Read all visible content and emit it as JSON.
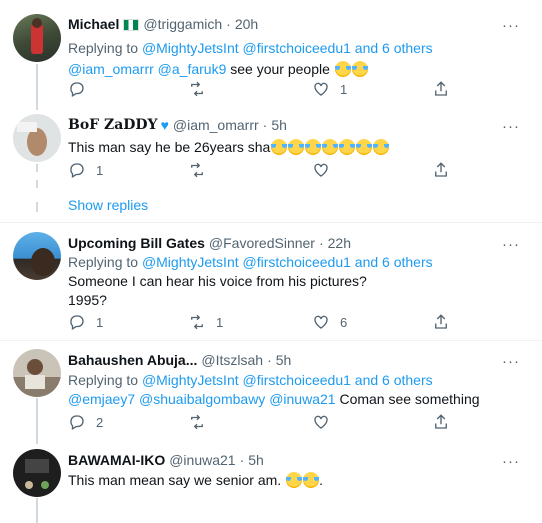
{
  "colors": {
    "accent": "#1d9bf0",
    "muted": "#536471",
    "text": "#0f1419"
  },
  "tweets": [
    {
      "name": "Michael",
      "handle": "@triggamich",
      "time": "20h",
      "flag": "nigeria-flag",
      "replying_prefix": "Replying to",
      "replying_to": "@MightyJetsInt @firstchoiceedu1",
      "replying_and": "and 6 others",
      "text_mentions": "@iam_omarrr @a_faruk9",
      "text": " see your people",
      "emoji_count": 2,
      "replies": "",
      "retweets": "",
      "likes": "1"
    },
    {
      "name": "BoF ZaDDY",
      "verified_icon": "blue-heart-icon",
      "handle": "@iam_omarrr",
      "time": "5h",
      "text": "This man say he be 26years sha",
      "emoji_count": 7,
      "replies": "1",
      "retweets": "",
      "likes": ""
    },
    {
      "name": "Upcoming Bill Gates",
      "handle": "@FavoredSinner",
      "time": "22h",
      "replying_prefix": "Replying to",
      "replying_to": "@MightyJetsInt @firstchoiceedu1",
      "replying_and": "and 6 others",
      "text": "Someone I can hear his voice from his pictures?",
      "text2": "1995?",
      "replies": "1",
      "retweets": "1",
      "likes": "6"
    },
    {
      "name": "Bahaushen Abuja...",
      "handle": "@Itszlsah",
      "time": "5h",
      "replying_prefix": "Replying to",
      "replying_to": "@MightyJetsInt @firstchoiceedu1",
      "replying_and": "and 6 others",
      "text_mentions": "@emjaey7 @shuaibalgombawy @inuwa21",
      "text": " Coman see something",
      "replies": "2",
      "retweets": "",
      "likes": ""
    },
    {
      "name": "BAWAMAI-IKO",
      "handle": "@inuwa21",
      "time": "5h",
      "text": "This man mean say we senior am.",
      "text_after": ".",
      "emoji_count": 2
    }
  ],
  "show_replies": "Show replies",
  "more_glyph": "···",
  "dot": "·"
}
